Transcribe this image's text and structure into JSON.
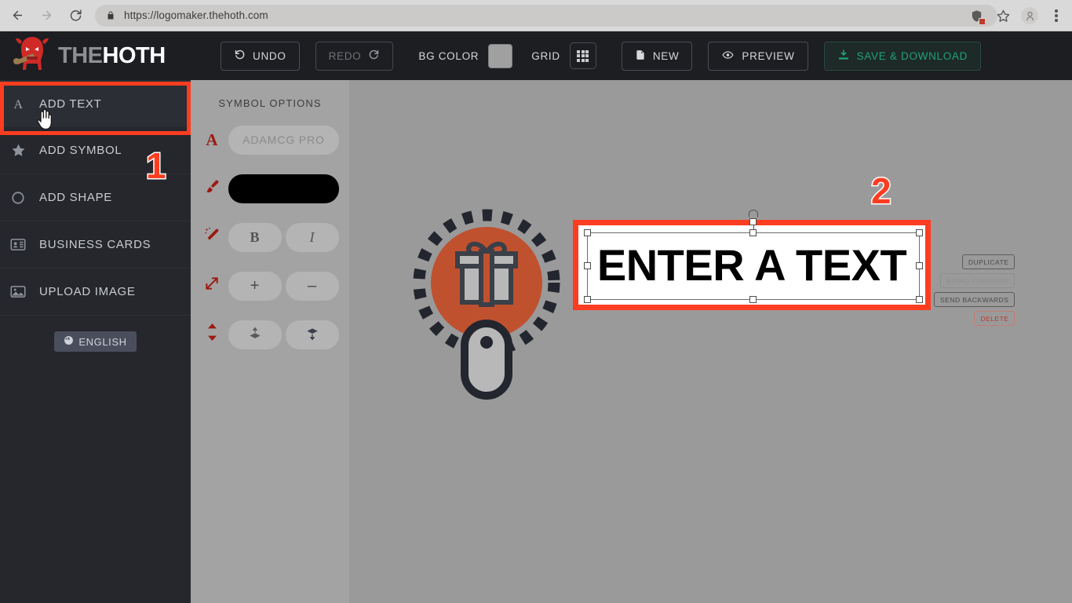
{
  "browser": {
    "url": "https://logomaker.thehoth.com",
    "back_icon": "back-arrow-icon",
    "forward_icon": "forward-arrow-icon",
    "reload_icon": "reload-icon",
    "lock_icon": "lock-icon",
    "extension_icon": "extension-shield-icon",
    "bookmark_icon": "star-icon",
    "profile_icon": "profile-avatar-icon",
    "menu_icon": "three-dot-menu-icon"
  },
  "header": {
    "logo_the": "THE",
    "logo_hoth": "HOTH",
    "toolbar": {
      "undo": "UNDO",
      "redo": "REDO",
      "bg_color": "BG COLOR",
      "bg_color_value": "#a0a0a0",
      "grid": "GRID",
      "new": "NEW",
      "preview": "PREVIEW",
      "save_download": "SAVE & DOWNLOAD",
      "save_download_color": "#22a07b"
    }
  },
  "sidebar": {
    "items": [
      {
        "label": "ADD TEXT",
        "icon": "text-a-icon",
        "active": true
      },
      {
        "label": "ADD SYMBOL",
        "icon": "star-icon",
        "active": false
      },
      {
        "label": "ADD SHAPE",
        "icon": "circle-icon",
        "active": false
      },
      {
        "label": "BUSINESS CARDS",
        "icon": "business-card-icon",
        "active": false
      },
      {
        "label": "UPLOAD IMAGE",
        "icon": "image-upload-icon",
        "active": false
      }
    ],
    "language": "ENGLISH",
    "language_icon": "globe-icon"
  },
  "options_panel": {
    "title": "SYMBOL OPTIONS",
    "font_name": "ADAMCG PRO",
    "font_icon": "font-a-icon",
    "color_icon": "paintbrush-icon",
    "color_value": "#000000",
    "style_icon": "magic-wand-icon",
    "bold_label": "B",
    "italic_label": "I",
    "size_icon": "resize-arrows-icon",
    "increase_label": "+",
    "decrease_label": "–",
    "layer_icon": "layer-updown-icon",
    "bring_forward_glyph": "bring-forward-icon",
    "send_backward_glyph": "send-backward-icon"
  },
  "canvas": {
    "background": "#9a9a9a",
    "logo": {
      "name": "gift-logo-graphic",
      "circle_color": "#c0512f",
      "ring_style": "dashed",
      "gift_icon": "gift-box-icon",
      "tag_icon": "luggage-tag-icon"
    },
    "text_object": {
      "value": "ENTER A TEXT",
      "selected": true,
      "color": "#000000"
    },
    "context_menu": [
      {
        "label": "DUPLICATE",
        "state": "enabled"
      },
      {
        "label": "BRING FORWARD",
        "state": "disabled"
      },
      {
        "label": "SEND BACKWARDS",
        "state": "enabled"
      },
      {
        "label": "DELETE",
        "state": "danger"
      }
    ]
  },
  "annotations": {
    "number_one": "1",
    "number_two": "2",
    "highlight_color": "#fc3d21",
    "cursor": "hand-pointer-cursor"
  }
}
